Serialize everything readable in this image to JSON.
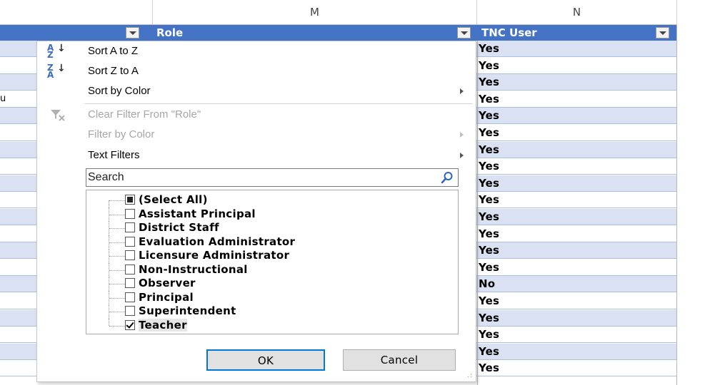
{
  "columns": {
    "m": "M",
    "n": "N"
  },
  "header_row": {
    "role": "Role",
    "tnc_user": "TNC User"
  },
  "left_stub": "u",
  "tnc_values": [
    "Yes",
    "Yes",
    "Yes",
    "Yes",
    "Yes",
    "Yes",
    "Yes",
    "Yes",
    "Yes",
    "Yes",
    "Yes",
    "Yes",
    "Yes",
    "Yes",
    "No",
    "Yes",
    "Yes",
    "Yes",
    "Yes",
    "Yes"
  ],
  "menu": {
    "sort_az": "Sort A to Z",
    "sort_za": "Sort Z to A",
    "sort_by_color": "Sort by Color",
    "clear_filter": "Clear Filter From \"Role\"",
    "filter_by_color": "Filter by Color",
    "text_filters": "Text Filters",
    "search_placeholder": "Search",
    "items": [
      {
        "label": "(Select All)",
        "state": "partial"
      },
      {
        "label": "Assistant Principal",
        "state": "unchecked"
      },
      {
        "label": "District Staff",
        "state": "unchecked"
      },
      {
        "label": "Evaluation Administrator",
        "state": "unchecked"
      },
      {
        "label": "Licensure Administrator",
        "state": "unchecked"
      },
      {
        "label": "Non-Instructional",
        "state": "unchecked"
      },
      {
        "label": "Observer",
        "state": "unchecked"
      },
      {
        "label": "Principal",
        "state": "unchecked"
      },
      {
        "label": "Superintendent",
        "state": "unchecked"
      },
      {
        "label": "Teacher",
        "state": "checked"
      }
    ],
    "ok": "OK",
    "cancel": "Cancel"
  },
  "colors": {
    "header_blue": "#4472c4",
    "band": "#d9e1f2",
    "ok_border": "#0078d7"
  }
}
